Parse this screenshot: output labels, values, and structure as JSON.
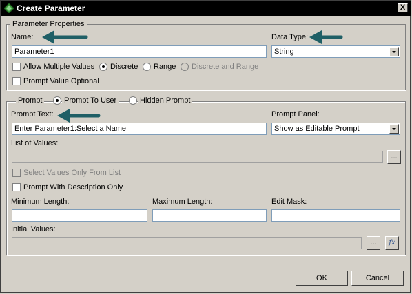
{
  "window": {
    "title": "Create Parameter",
    "close_symbol": "X"
  },
  "parameter_properties": {
    "legend": "Parameter Properties",
    "name_label": "Name:",
    "name_value": "Parameter1",
    "data_type_label": "Data Type:",
    "data_type_value": "String",
    "allow_multiple_label": "Allow Multiple Values",
    "discrete_label": "Discrete",
    "range_label": "Range",
    "discrete_and_range_label": "Discrete and Range",
    "prompt_optional_label": "Prompt Value Optional"
  },
  "prompt": {
    "legend": "Prompt",
    "prompt_to_user_label": "Prompt To User",
    "hidden_prompt_label": "Hidden Prompt",
    "prompt_text_label": "Prompt Text:",
    "prompt_text_value": "Enter Parameter1:Select a Name",
    "prompt_panel_label": "Prompt Panel:",
    "prompt_panel_value": "Show as Editable Prompt",
    "list_of_values_label": "List of Values:",
    "browse_label": "...",
    "select_only_label": "Select Values Only From List",
    "with_description_label": "Prompt With Description Only",
    "min_length_label": "Minimum Length:",
    "max_length_label": "Maximum Length:",
    "edit_mask_label": "Edit Mask:",
    "initial_values_label": "Initial Values:",
    "fx_label": "fx"
  },
  "footer": {
    "ok_label": "OK",
    "cancel_label": "Cancel"
  },
  "colors": {
    "annotation_arrow": "#1f5f66",
    "title_bar": "#000000"
  }
}
